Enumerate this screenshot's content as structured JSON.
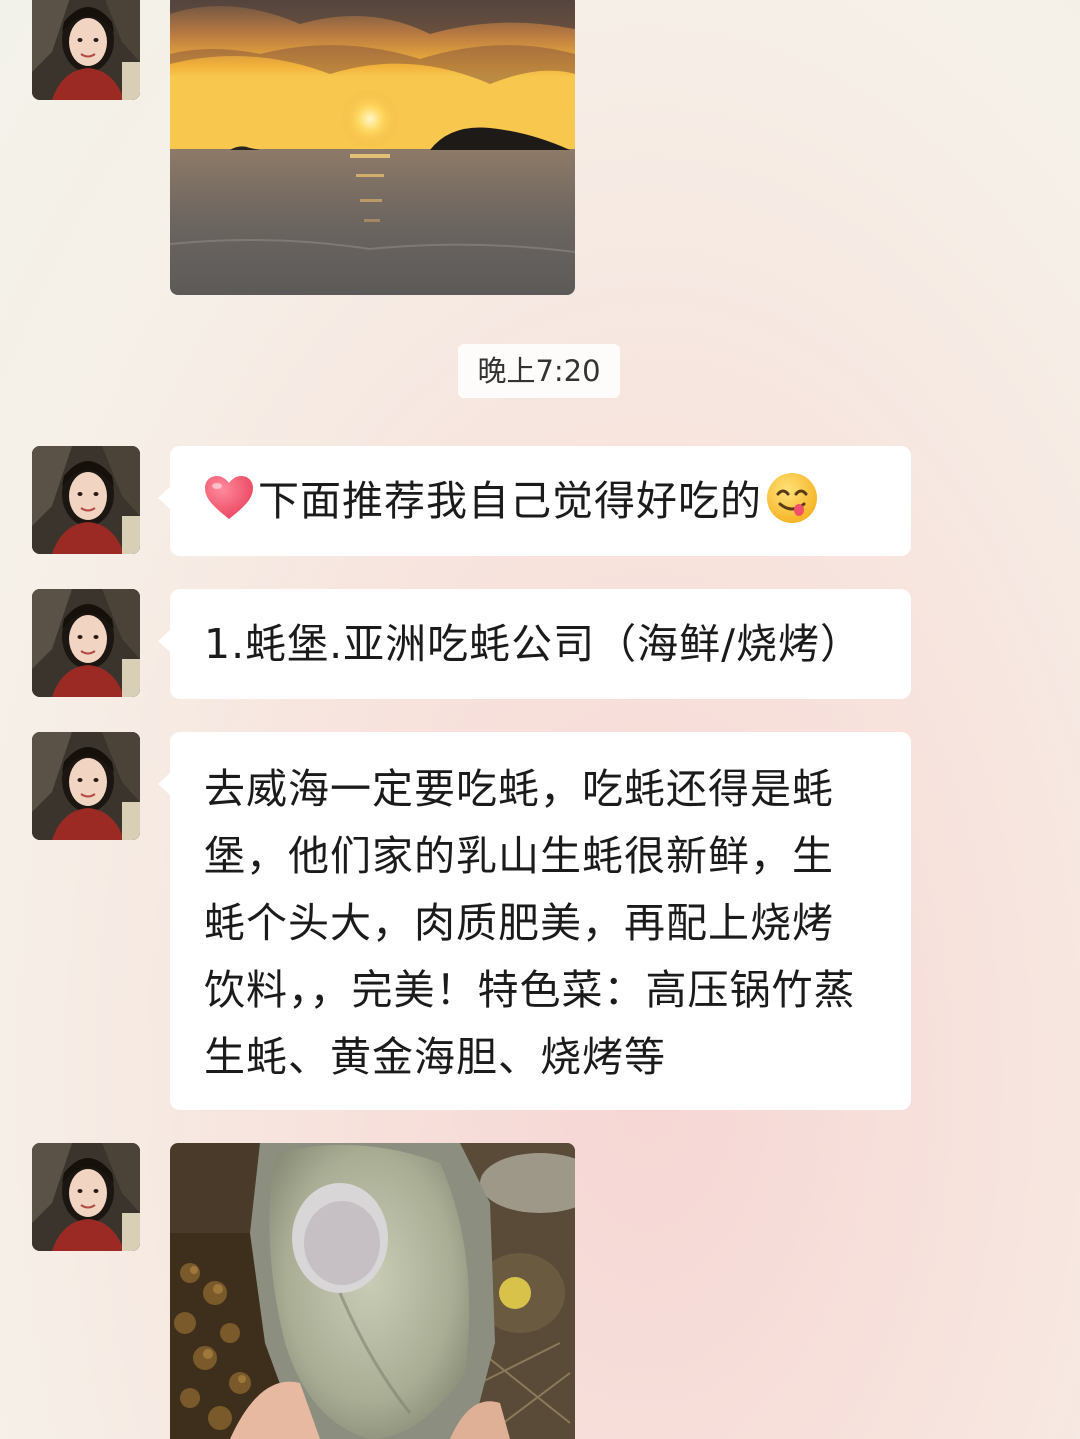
{
  "chat": {
    "timestamp": "晚上7:20",
    "messages": [
      {
        "type": "image",
        "name": "sunset-photo",
        "alt": "sunset"
      },
      {
        "type": "text",
        "icon_before": "red-heart-icon",
        "text": "下面推荐我自己觉得好吃的",
        "icon_after": "yum-face-emoji-icon"
      },
      {
        "type": "text",
        "text": "1.蚝堡.亚洲吃蚝公司（海鲜/烧烤）"
      },
      {
        "type": "text",
        "lines": [
          "去威海一定要吃蚝，吃蚝还得是蚝",
          "堡，他们家的乳山生蚝很新鲜，生",
          "蚝个头大，肉质肥美，再配上烧烤",
          "饮料，，完美！特色菜：高压锅竹蒸",
          "生蚝、黄金海胆、烧烤等"
        ]
      },
      {
        "type": "image",
        "name": "oyster-photo"
      }
    ]
  },
  "colors": {
    "bubble": "#ffffff",
    "text": "#1b1b1b",
    "heart": "#e8405a"
  }
}
